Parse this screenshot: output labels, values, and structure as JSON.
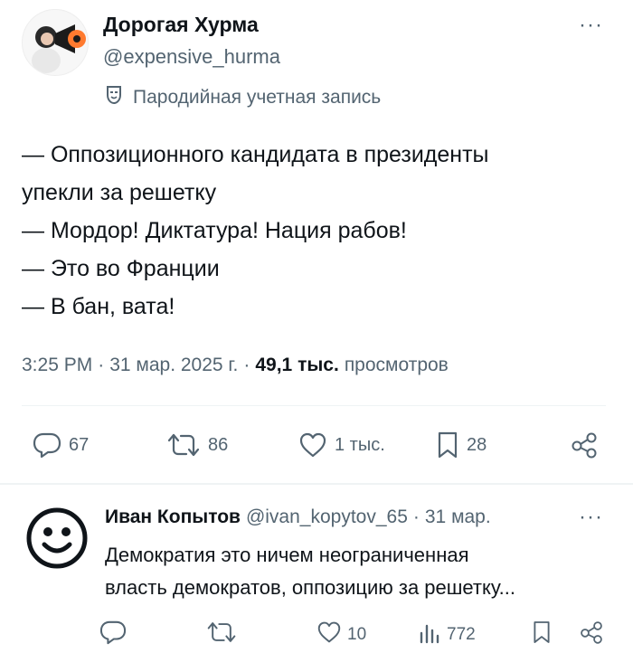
{
  "tweet": {
    "author_name": "Дорогая Хурма",
    "author_handle": "@expensive_hurma",
    "more": "···",
    "parody_label": "Пародийная учетная запись",
    "lines": [
      "— Оппозиционного кандидата в президенты",
      "упекли за решетку",
      "— Мордор! Диктатура! Нация рабов!",
      "— Это во Франции",
      "— В бан, вата!"
    ],
    "time": "3:25 PM",
    "dot": "·",
    "date": "31 мар. 2025 г.",
    "views_count": "49,1 тыс.",
    "views_label": "просмотров",
    "stats": {
      "replies": "67",
      "reposts": "86",
      "likes": "1 тыс.",
      "bookmarks": "28"
    }
  },
  "reply": {
    "author_name": "Иван Копытов",
    "author_handle": "@ivan_kopytov_65",
    "dot": "·",
    "date": "31 мар.",
    "more": "···",
    "lines": [
      "Демократия это ничем неограниченная",
      "власть демократов, оппозицию за решетку..."
    ],
    "stats": {
      "likes": "10",
      "views": "772"
    }
  },
  "colors": {
    "text": "#0f1419",
    "muted": "#536471",
    "divider": "#eff3f4"
  },
  "icons": [
    "reply-icon",
    "repost-icon",
    "like-icon",
    "bookmark-icon",
    "share-icon",
    "views-icon",
    "parody-mask-icon",
    "more-icon"
  ]
}
